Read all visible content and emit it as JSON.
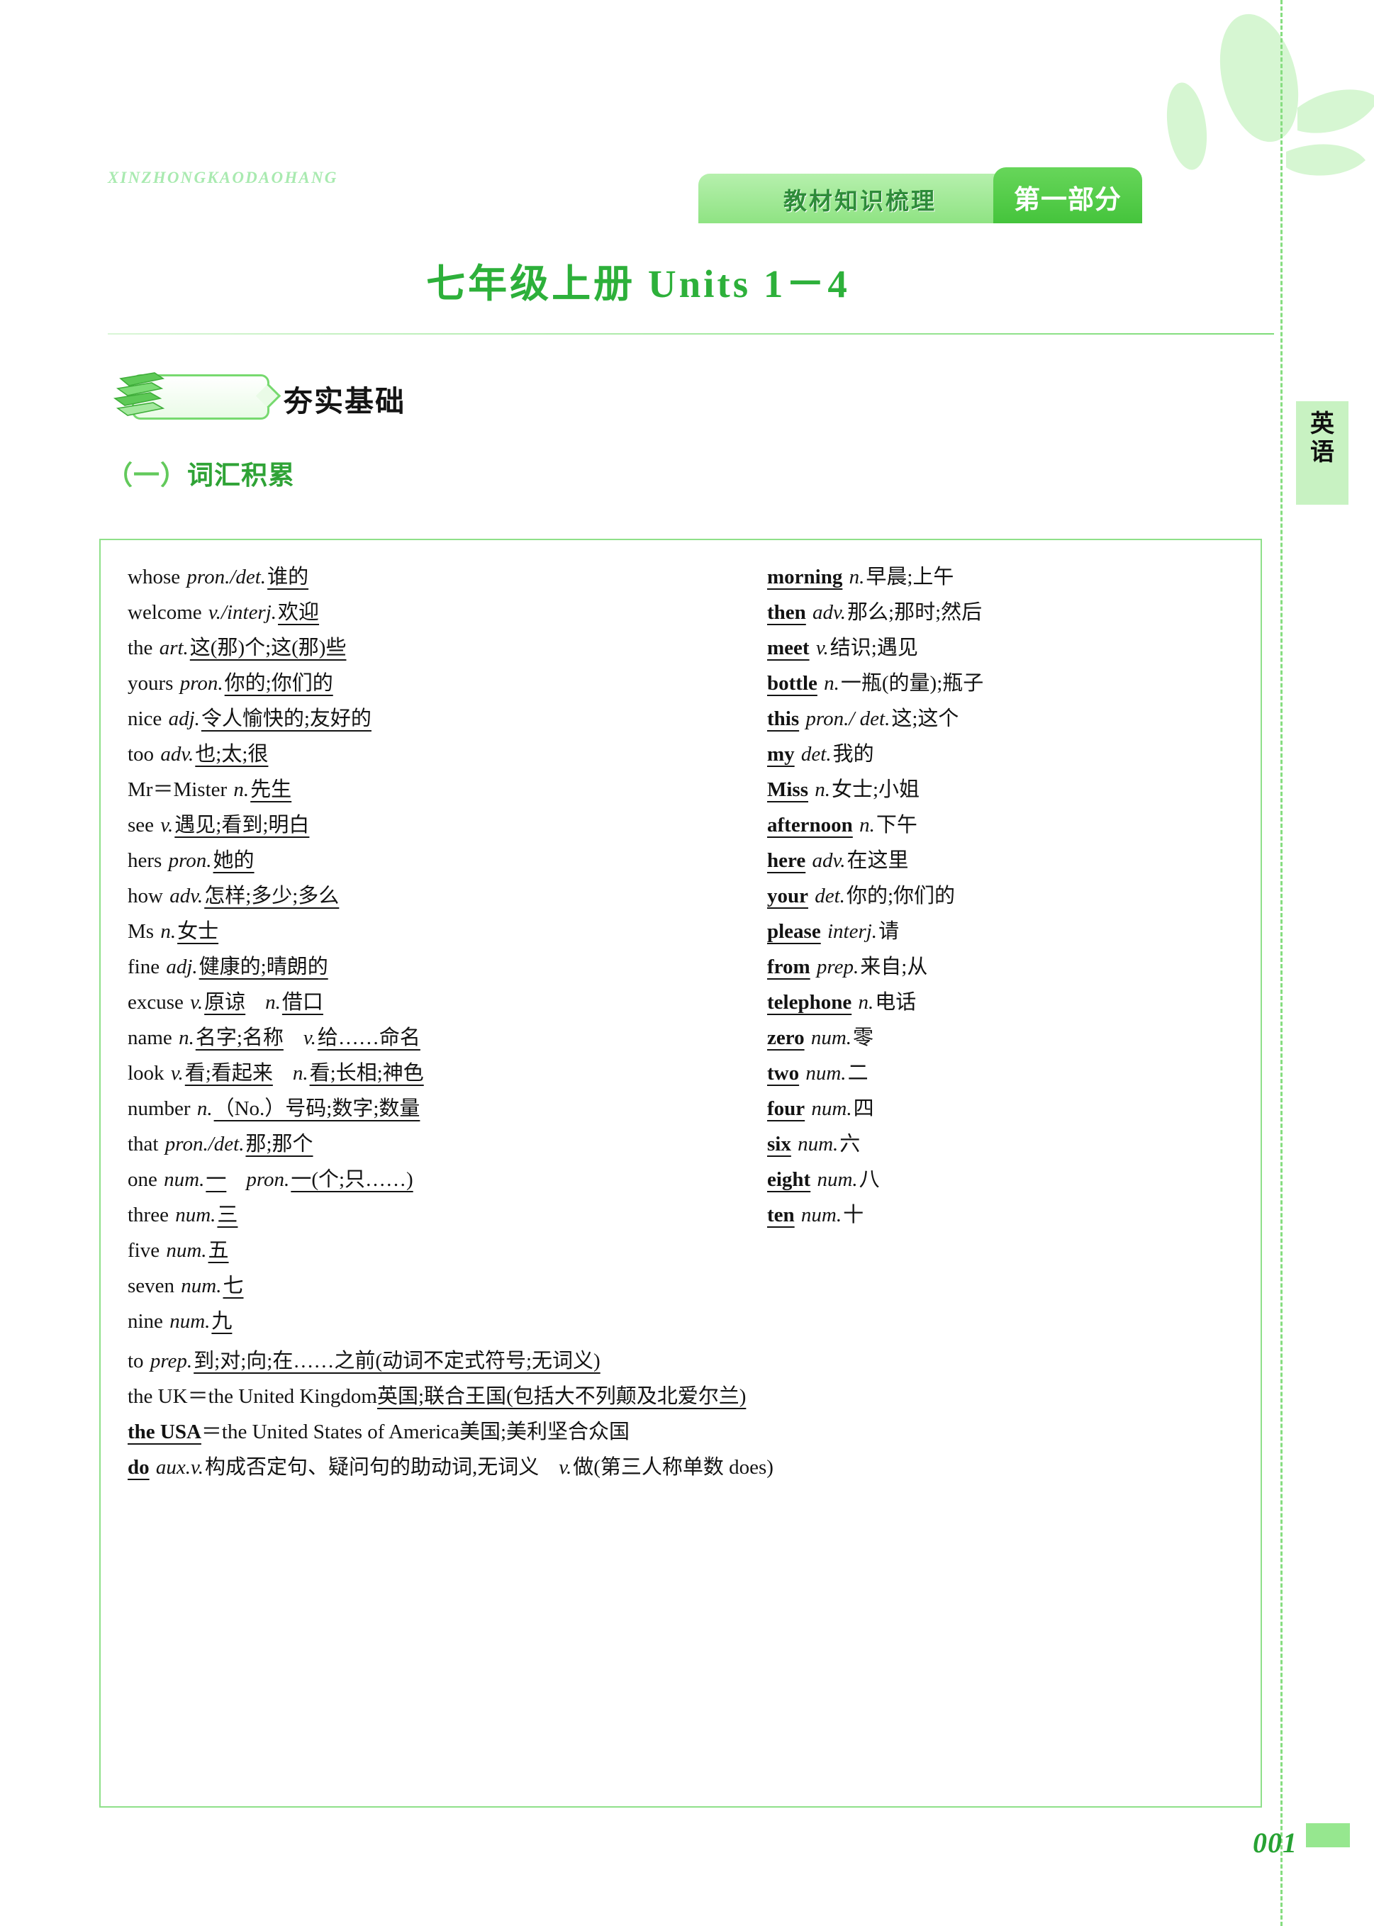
{
  "running_head": "XINZHONGKAODAOHANG",
  "header": {
    "subject_banner": "教材知识梳理",
    "part_banner": "第一部分"
  },
  "unit_title": "七年级上册 Units 1－4",
  "section": {
    "icon": "stacked-books-icon",
    "label": "夯实基础"
  },
  "subsection": {
    "number": "（一）",
    "label": "词汇积累"
  },
  "edge_tab": {
    "label": "英\n语"
  },
  "page_number": "001",
  "vocabulary": {
    "left_column": [
      {
        "word": "whose",
        "pos": "pron./det.",
        "meaning": "谁的"
      },
      {
        "word": "welcome",
        "pos": "v./interj.",
        "meaning": "欢迎"
      },
      {
        "word": "the",
        "pos": "art.",
        "meaning": "这(那)个;这(那)些"
      },
      {
        "word": "yours",
        "pos": "pron.",
        "meaning": "你的;你们的"
      },
      {
        "word": "nice",
        "pos": "adj.",
        "meaning": "令人愉快的;友好的"
      },
      {
        "word": "too",
        "pos": "adv.",
        "meaning": "也;太;很"
      },
      {
        "word": "Mr＝Mister",
        "pos": "n.",
        "meaning": "先生"
      },
      {
        "word": "see",
        "pos": "v.",
        "meaning": "遇见;看到;明白"
      },
      {
        "word": "hers",
        "pos": "pron.",
        "meaning": "她的"
      },
      {
        "word": "how",
        "pos": "adv.",
        "meaning": "怎样;多少;多么"
      },
      {
        "word": "Ms",
        "pos": "n.",
        "meaning": "女士"
      },
      {
        "word": "fine",
        "pos": "adj.",
        "meaning": "健康的;晴朗的"
      },
      {
        "word": "excuse",
        "pos": "v.",
        "meaning": "原谅",
        "pos2": "n.",
        "meaning2": "借口"
      },
      {
        "word": "name",
        "pos": "n.",
        "meaning": "名字;名称",
        "pos2": "v.",
        "meaning2": "给……命名"
      },
      {
        "word": "look",
        "pos": "v.",
        "meaning": "看;看起来",
        "pos2": "n.",
        "meaning2": "看;长相;神色"
      },
      {
        "word": "number",
        "pos": "n.",
        "meaning": "（No.）号码;数字;数量"
      },
      {
        "word": "that",
        "pos": "pron./det.",
        "meaning": "那;那个"
      },
      {
        "word": "one",
        "pos": "num.",
        "meaning": "一",
        "pos2": "pron.",
        "meaning2": "一(个;只……)"
      },
      {
        "word": "three",
        "pos": "num.",
        "meaning": "三"
      },
      {
        "word": "five",
        "pos": "num.",
        "meaning": "五"
      },
      {
        "word": "seven",
        "pos": "num.",
        "meaning": "七"
      },
      {
        "word": "nine",
        "pos": "num.",
        "meaning": "九"
      }
    ],
    "right_column": [
      {
        "word": "morning",
        "pos": "n.",
        "meaning": "早晨;上午"
      },
      {
        "word": "then",
        "pos": "adv.",
        "meaning": "那么;那时;然后"
      },
      {
        "word": "meet",
        "pos": "v.",
        "meaning": "结识;遇见"
      },
      {
        "word": "bottle",
        "pos": "n.",
        "meaning": "一瓶(的量);瓶子"
      },
      {
        "word": "this",
        "pos": "pron./ det.",
        "meaning": "这;这个"
      },
      {
        "word": "my",
        "pos": "det.",
        "meaning": "我的"
      },
      {
        "word": "Miss",
        "pos": "n.",
        "meaning": "女士;小姐"
      },
      {
        "word": "afternoon",
        "pos": "n.",
        "meaning": "下午"
      },
      {
        "word": "here",
        "pos": "adv.",
        "meaning": "在这里"
      },
      {
        "word": "your",
        "pos": "det.",
        "meaning": "你的;你们的"
      },
      {
        "word": "please",
        "pos": "interj.",
        "meaning": "请"
      },
      {
        "word": "from",
        "pos": "prep.",
        "meaning": "来自;从"
      },
      {
        "word": "telephone",
        "pos": "n.",
        "meaning": "电话"
      },
      {
        "word": "zero",
        "pos": "num.",
        "meaning": "零"
      },
      {
        "word": "two",
        "pos": "num.",
        "meaning": "二"
      },
      {
        "word": "four",
        "pos": "num.",
        "meaning": "四"
      },
      {
        "word": "six",
        "pos": "num.",
        "meaning": "六"
      },
      {
        "word": "eight",
        "pos": "num.",
        "meaning": "八"
      },
      {
        "word": "ten",
        "pos": "num.",
        "meaning": "十"
      }
    ],
    "full_width_rows": [
      {
        "word": "to",
        "pos": "prep.",
        "meaning": "到;对;向;在……之前(动词不定式符号;无词义)"
      },
      {
        "word": "the UK",
        "equals": "＝the United Kingdom",
        "meaning": "英国;联合王国(包括大不列颠及北爱尔兰)"
      },
      {
        "word": "the USA",
        "word_blank": true,
        "equals": "＝the United States of America",
        "meaning": "美国;美利坚合众国"
      },
      {
        "word": "do",
        "word_blank": true,
        "pos": "aux.v.",
        "meaning": "构成否定句、疑问句的助动词,无词义",
        "pos2": "v.",
        "meaning2": "做(第三人称单数 does)"
      }
    ]
  },
  "colors": {
    "brand_green": "#2db03a",
    "light_green": "#b6f0ad",
    "dark_green": "#45c43c",
    "tab_green": "#c8f2c2"
  }
}
